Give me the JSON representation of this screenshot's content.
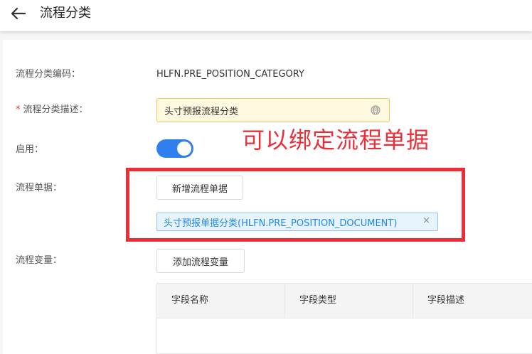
{
  "header": {
    "title": "流程分类"
  },
  "form": {
    "code_label": "流程分类编码：",
    "code_value": "HLFN.PRE_POSITION_CATEGORY",
    "required_mark": "*",
    "desc_label": "流程分类描述：",
    "desc_value": "头寸预报流程分类",
    "enable_label": "启用：",
    "enabled": true,
    "docs_label": "流程单据：",
    "add_doc_button": "新增流程单据",
    "doc_tags": [
      {
        "text": "头寸预报单据分类(HLFN.PRE_POSITION_DOCUMENT)",
        "close": "×"
      }
    ],
    "vars_label": "流程变量：",
    "add_var_button": "添加流程变量"
  },
  "table": {
    "columns": [
      "字段名称",
      "字段类型",
      "字段描述"
    ]
  },
  "annotation": {
    "text": "可以绑定流程单据",
    "color": "#e8303a"
  },
  "colors": {
    "accent": "#2f7fef",
    "required": "#e4393c",
    "annotation_box": "#ef2d36"
  },
  "icons": {
    "back": "arrow-left-icon",
    "language": "globe-icon",
    "tag_close": "close-icon"
  }
}
